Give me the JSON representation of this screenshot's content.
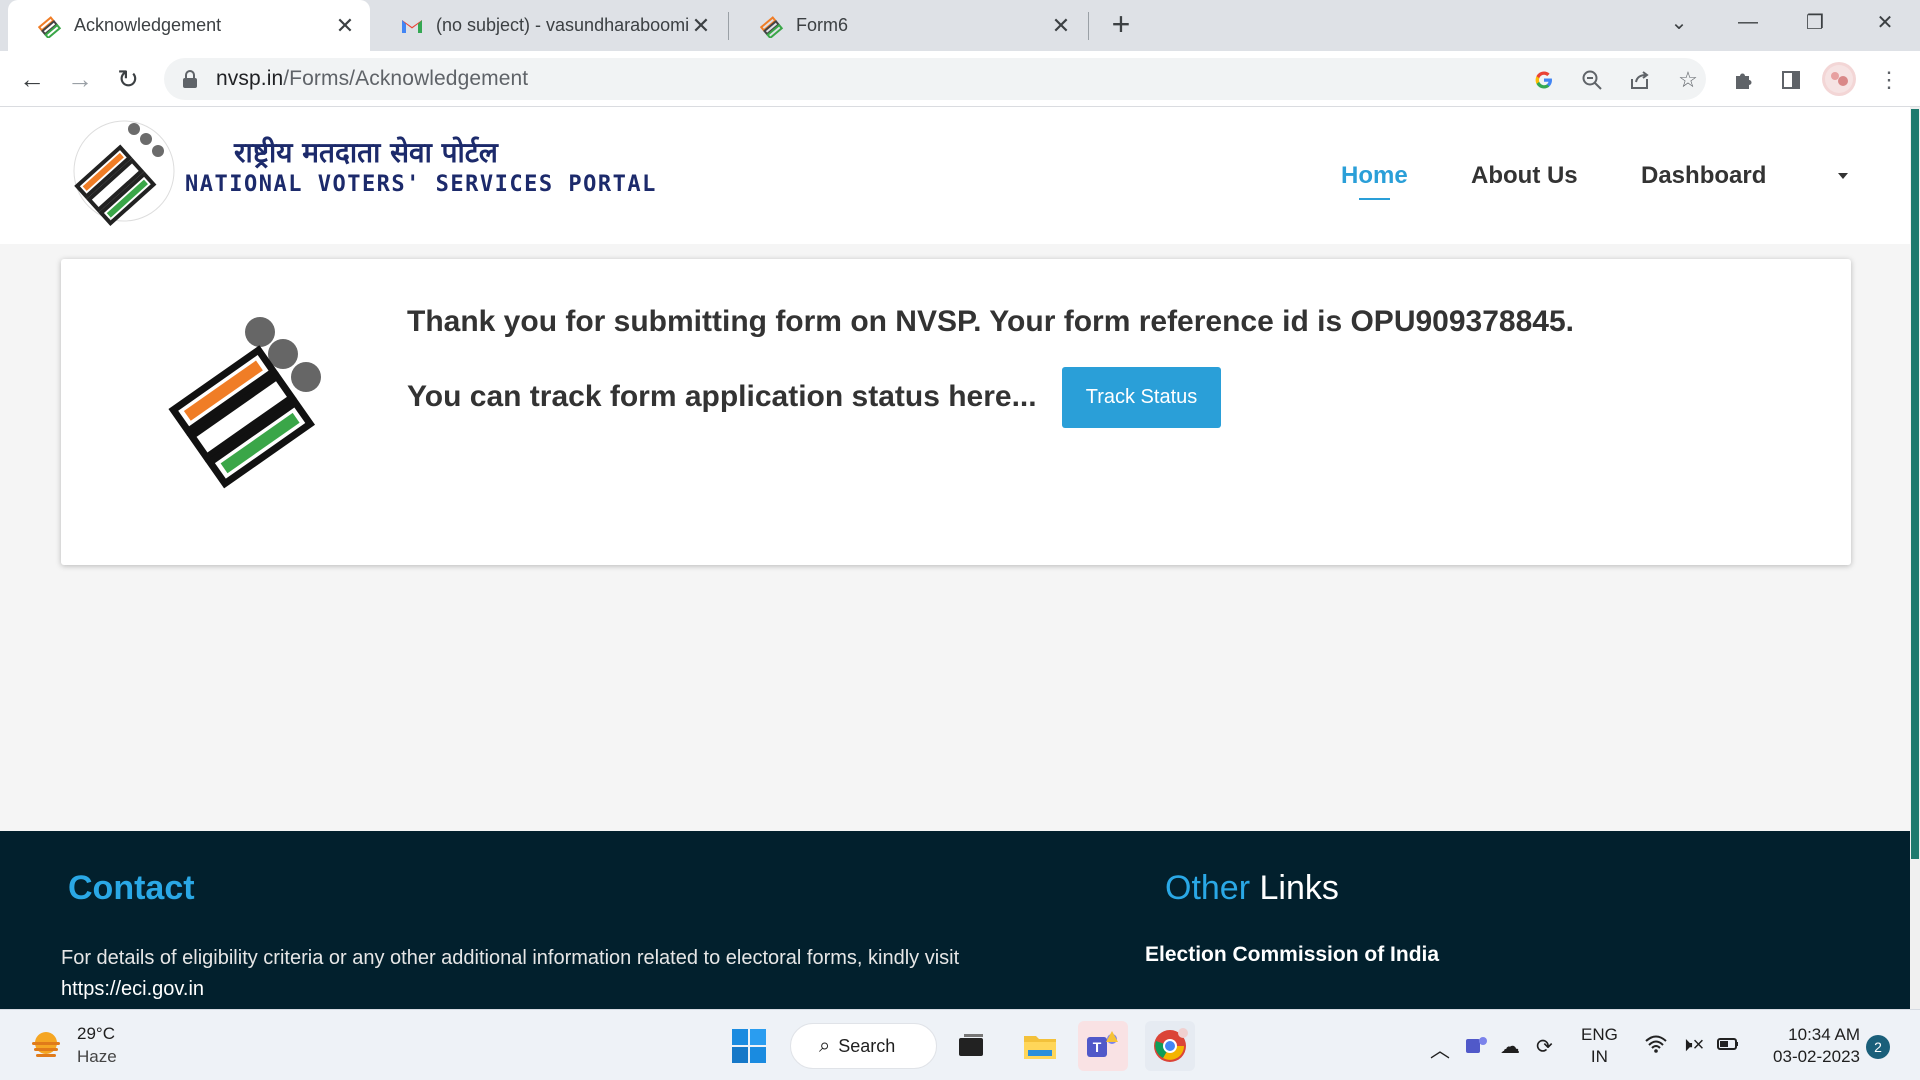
{
  "browser": {
    "tabs": [
      {
        "title": "Acknowledgement",
        "active": true
      },
      {
        "title": "(no subject) - vasundharaboomi@",
        "active": false
      },
      {
        "title": "Form6",
        "active": false
      }
    ],
    "url_host": "nvsp.in",
    "url_path": "/Forms/Acknowledgement"
  },
  "site": {
    "brand_hindi": "राष्ट्रीय मतदाता सेवा पोर्टल",
    "brand_english": "NATIONAL VOTERS' SERVICES PORTAL",
    "nav": {
      "home": "Home",
      "about": "About Us",
      "dashboard": "Dashboard"
    }
  },
  "acknowledgement": {
    "message": "Thank you for submitting form on NVSP. Your form reference id is OPU909378845.",
    "track_prompt": "You can track form application status here...",
    "track_button": "Track Status"
  },
  "footer": {
    "contact_heading": "Contact",
    "other_links_accent": "Other",
    "other_links_rest": " Links",
    "contact_text": "For details of eligibility criteria or any other additional information related to electoral forms, kindly visit",
    "contact_link": "https://eci.gov.in",
    "link_eci": "Election Commission of India"
  },
  "taskbar": {
    "weather_temp": "29°C",
    "weather_desc": "Haze",
    "search_label": "Search",
    "lang_top": "ENG",
    "lang_bottom": "IN",
    "time": "10:34 AM",
    "date": "03-02-2023",
    "notification_count": "2"
  },
  "colors": {
    "accent": "#2a9fd8",
    "footer_bg": "#02202d",
    "saffron": "#f07d26",
    "green": "#3aa648"
  }
}
